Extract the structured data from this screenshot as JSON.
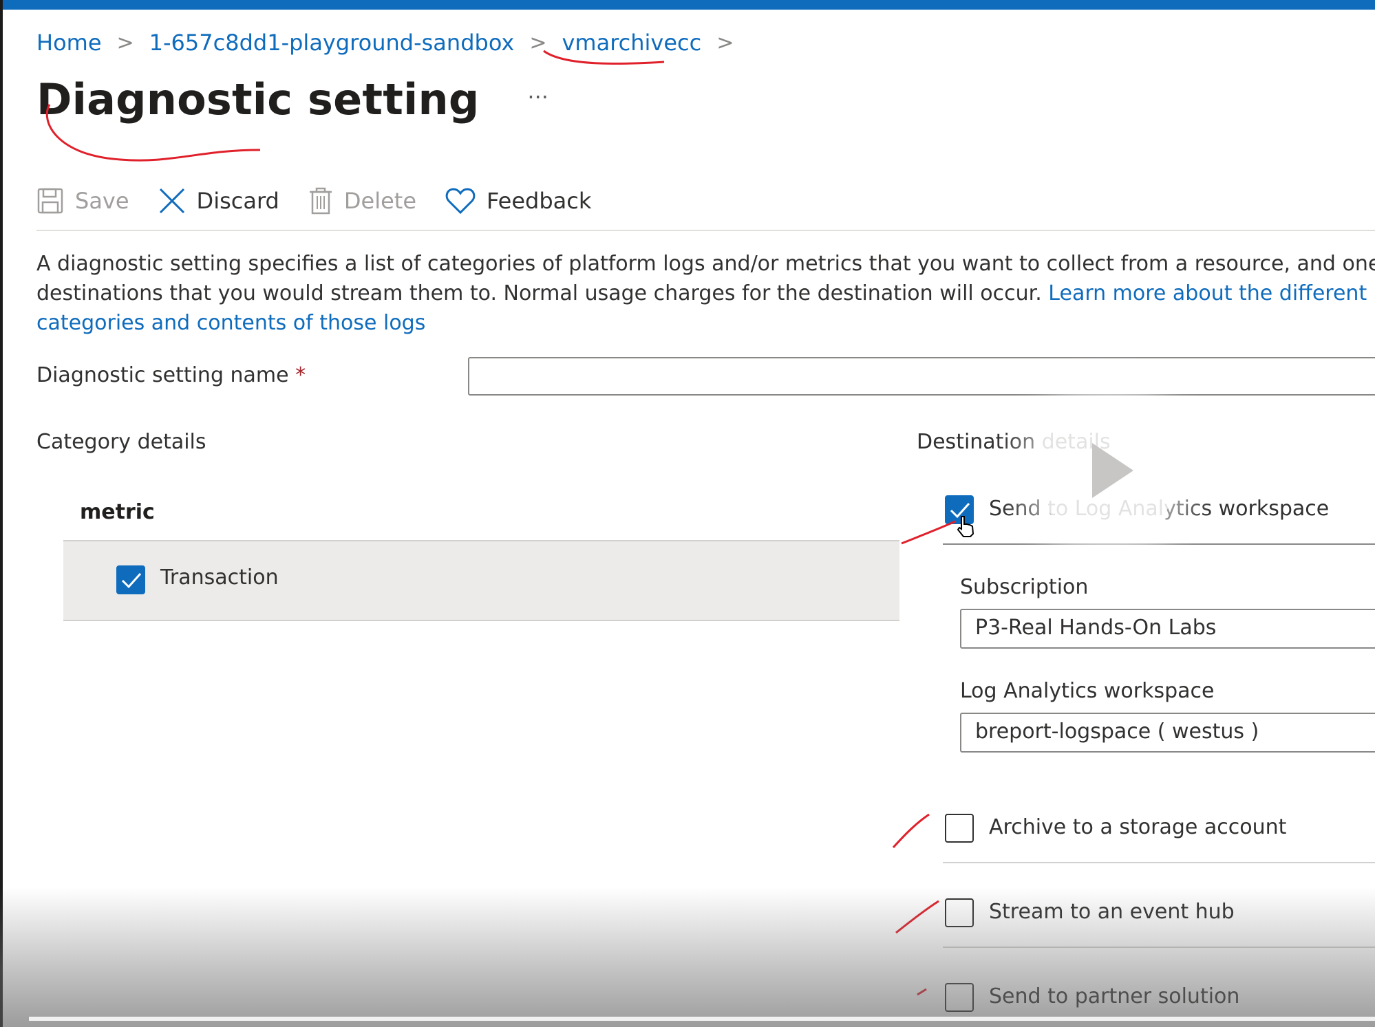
{
  "breadcrumb": {
    "items": [
      "Home",
      "1-657c8dd1-playground-sandbox",
      "vmarchivecc"
    ],
    "separator": ">"
  },
  "page": {
    "title": "Diagnostic setting",
    "more": "···"
  },
  "toolbar": {
    "save": "Save",
    "discard": "Discard",
    "delete": "Delete",
    "feedback": "Feedback"
  },
  "description": {
    "line1": "A diagnostic setting specifies a list of categories of platform logs and/or metrics that you want to collect from a resource, and one or more",
    "line2_text": "destinations that you would stream them to. Normal usage charges for the destination will occur. ",
    "line2_link": "Learn more about the different log",
    "line3_link": "categories and contents of those logs"
  },
  "form": {
    "name_label": "Diagnostic setting name",
    "required_marker": "*",
    "name_value": ""
  },
  "category": {
    "heading": "Category details",
    "group": "metric",
    "items": [
      {
        "label": "Transaction",
        "checked": true
      }
    ]
  },
  "destination": {
    "heading": "Destination details",
    "log_analytics": {
      "label": "Send to Log Analytics workspace",
      "checked": true
    },
    "subscription_label": "Subscription",
    "subscription_value": "P3-Real Hands-On Labs",
    "workspace_label": "Log Analytics workspace",
    "workspace_value": "breport-logspace ( westus )",
    "storage": {
      "label": "Archive to a storage account",
      "checked": false
    },
    "event_hub": {
      "label": "Stream to an event hub",
      "checked": false
    },
    "partner": {
      "label": "Send to partner solution",
      "checked": false
    }
  },
  "colors": {
    "accent": "#0f6cbd",
    "annotation": "#e0202a"
  },
  "icons": [
    "save-icon",
    "close-icon",
    "trash-icon",
    "heart-icon",
    "checkmark-icon",
    "play-icon",
    "pointer-hand-icon"
  ]
}
